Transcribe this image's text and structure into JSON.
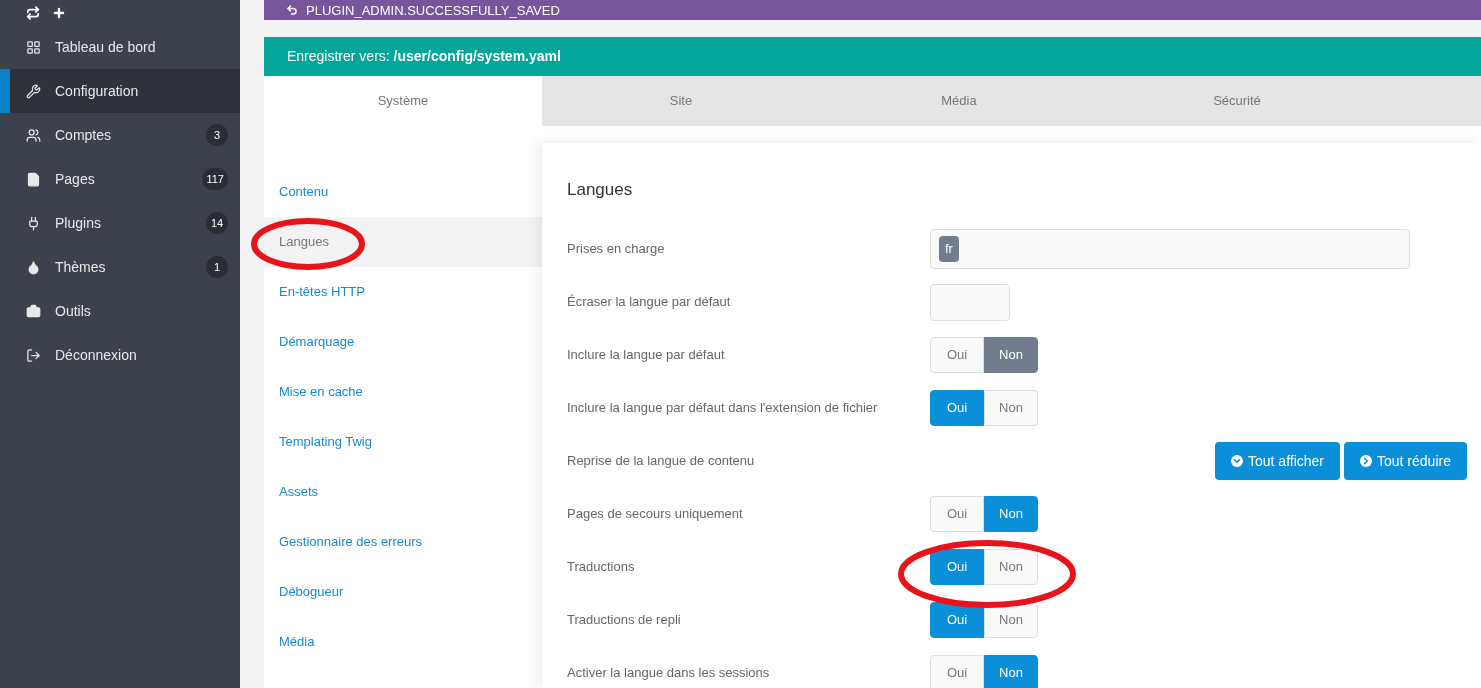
{
  "sidebar": {
    "items": [
      {
        "label": "Tableau de bord",
        "selected": false
      },
      {
        "label": "Configuration",
        "selected": true
      },
      {
        "label": "Comptes",
        "count": "3",
        "selected": false
      },
      {
        "label": "Pages",
        "count": "117",
        "selected": false
      },
      {
        "label": "Plugins",
        "count": "14",
        "selected": false
      },
      {
        "label": "Thèmes",
        "count": "1",
        "selected": false
      },
      {
        "label": "Outils",
        "selected": false
      },
      {
        "label": "Déconnexion",
        "selected": false
      }
    ]
  },
  "notice": "PLUGIN_ADMIN.SUCCESSFULLY_SAVED",
  "save_bar": "Enregistrer vers: **/user/config/system.yaml**",
  "tabs": [
    {
      "label": "Système",
      "selected": true
    },
    {
      "label": "Site",
      "selected": false
    },
    {
      "label": "Média",
      "selected": false
    },
    {
      "label": "Sécurité",
      "selected": false
    }
  ],
  "sections": [
    {
      "label": "Contenu",
      "selected": false
    },
    {
      "label": "Langues",
      "selected": true
    },
    {
      "label": "En-têtes HTTP",
      "selected": false
    },
    {
      "label": "Démarquage",
      "selected": false
    },
    {
      "label": "Mise en cache",
      "selected": false
    },
    {
      "label": "Templating Twig",
      "selected": false
    },
    {
      "label": "Assets",
      "selected": false
    },
    {
      "label": "Gestionnaire des erreurs",
      "selected": false
    },
    {
      "label": "Débogueur",
      "selected": false
    },
    {
      "label": "Média",
      "selected": false
    }
  ],
  "panel": {
    "title": "Langues",
    "rows": [
      {
        "kind": "tags",
        "label": "Prises en charge",
        "tags": [
          "fr"
        ]
      },
      {
        "kind": "text",
        "label": "Écraser la langue par défaut"
      },
      {
        "kind": "toggle",
        "label": "Inclure la langue par défaut",
        "muted": true,
        "options": [
          {
            "label": "Oui",
            "selected": false
          },
          {
            "label": "Non",
            "selected": true
          }
        ]
      },
      {
        "kind": "toggle",
        "label": "Inclure la langue par défaut dans l'extension de fichier",
        "muted": false,
        "options": [
          {
            "label": "Oui",
            "selected": true
          },
          {
            "label": "Non",
            "selected": false
          }
        ]
      },
      {
        "kind": "buttons",
        "label": "Reprise de la langue de contenu",
        "buttons": [
          {
            "label": "Tout afficher"
          },
          {
            "label": "Tout réduire"
          }
        ]
      },
      {
        "kind": "toggle",
        "label": "Pages de secours uniquement",
        "muted": false,
        "options": [
          {
            "label": "Oui",
            "selected": false
          },
          {
            "label": "Non",
            "selected": true
          }
        ]
      },
      {
        "kind": "toggle",
        "label": "Traductions",
        "muted": false,
        "options": [
          {
            "label": "Oui",
            "selected": true
          },
          {
            "label": "Non",
            "selected": false
          }
        ]
      },
      {
        "kind": "toggle",
        "label": "Traductions de repli",
        "muted": false,
        "options": [
          {
            "label": "Oui",
            "selected": true
          },
          {
            "label": "Non",
            "selected": false
          }
        ]
      },
      {
        "kind": "toggle",
        "label": "Activer la langue dans les sessions",
        "muted": false,
        "options": [
          {
            "label": "Oui",
            "selected": false
          },
          {
            "label": "Non",
            "selected": true
          }
        ]
      }
    ]
  }
}
